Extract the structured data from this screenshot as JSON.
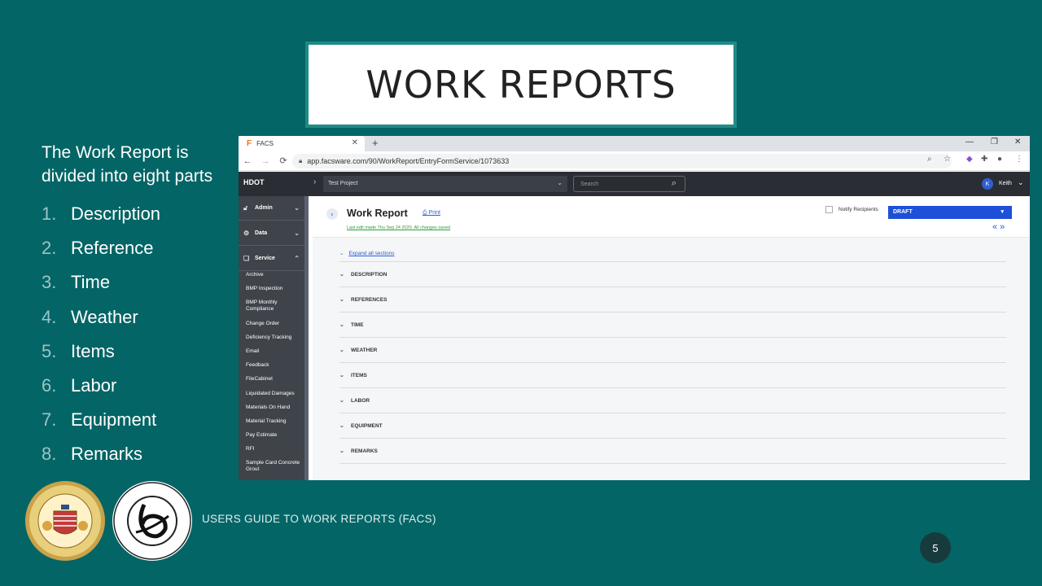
{
  "slide": {
    "title": "WORK REPORTS",
    "intro": "The Work Report is divided into eight parts",
    "parts": [
      {
        "num": "1.",
        "label": "Description"
      },
      {
        "num": "2.",
        "label": "Reference"
      },
      {
        "num": "3.",
        "label": "Time"
      },
      {
        "num": "4.",
        "label": "Weather"
      },
      {
        "num": "5.",
        "label": "Items"
      },
      {
        "num": "6.",
        "label": "Labor"
      },
      {
        "num": "7.",
        "label": "Equipment"
      },
      {
        "num": "8.",
        "label": "Remarks"
      }
    ],
    "footer": "USERS GUIDE TO WORK REPORTS  (FACS)",
    "page_number": "5",
    "colors": {
      "background": "#036566",
      "title_border": "#1f8a86"
    }
  },
  "browser": {
    "tab_title": "FACS",
    "favicon": "F",
    "url": "app.facsware.com/90/WorkReport/EntryFormService/1073633"
  },
  "app": {
    "brand": "HDOT",
    "project": "Test Project",
    "search_placeholder": "Search",
    "user_initial": "K",
    "user_name": "Keith",
    "sidebar": {
      "groups": [
        {
          "label": "Admin",
          "icon": "lock-icon"
        },
        {
          "label": "Data",
          "icon": "gears-icon"
        },
        {
          "label": "Service",
          "icon": "copy-icon"
        }
      ],
      "items": [
        "Archive",
        "BMP Inspection",
        "BMP Monthly Compliance",
        "Change Order",
        "Deficiency Tracking",
        "Email",
        "Feedback",
        "FileCabinet",
        "Liquidated Damages",
        "Materials On Hand",
        "Material Tracking",
        "Pay Estimate",
        "RFI",
        "Sample Card Concrete Grout"
      ]
    },
    "header": {
      "title": "Work Report",
      "print_label": "Print",
      "last_edit": "Last edit made Thu Sep 24 2020. All changes saved",
      "notify_label": "Notify Recipients",
      "status": "DRAFT",
      "accent": "#1d4fd8"
    },
    "expand_all": "Expand all sections",
    "sections": [
      "DESCRIPTION",
      "REFERENCES",
      "TIME",
      "WEATHER",
      "ITEMS",
      "LABOR",
      "EQUIPMENT",
      "REMARKS"
    ]
  }
}
